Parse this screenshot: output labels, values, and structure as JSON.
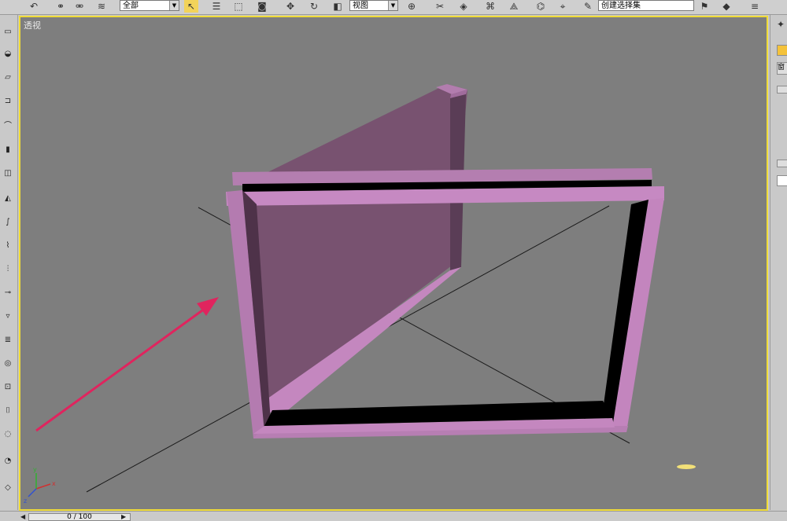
{
  "viewport": {
    "label": "透视"
  },
  "toolbar": {
    "selection_filter": "全部",
    "reference_coord": "视图",
    "named_selection": "创建选择集",
    "icons": [
      "undo-icon",
      "select-link-icon",
      "unlink-icon",
      "bind-spacewarp-icon",
      "select-object-icon",
      "select-by-name-icon",
      "select-region-icon",
      "window-crossing-icon",
      "move-icon",
      "rotate-icon",
      "scale-icon",
      "pivot-icon",
      "mirror-icon",
      "align-icon",
      "layer-icon",
      "curve-editor-icon",
      "schematic-icon",
      "material-editor-icon",
      "render-setup-icon",
      "render-icon"
    ]
  },
  "timeline": {
    "frame_label": "0 / 100"
  },
  "right_panel": {
    "label": "窗"
  },
  "colors": {
    "viewport_bg": "#7e7e7e",
    "viewport_border": "#f0dc38",
    "object_face": "#795372",
    "object_edge": "#c487bf",
    "arrow": "#e0245e"
  },
  "scene_objects": [
    "window-frame",
    "window-sash",
    "ground-grid-axes",
    "annotation-arrow",
    "axis-tripod"
  ]
}
